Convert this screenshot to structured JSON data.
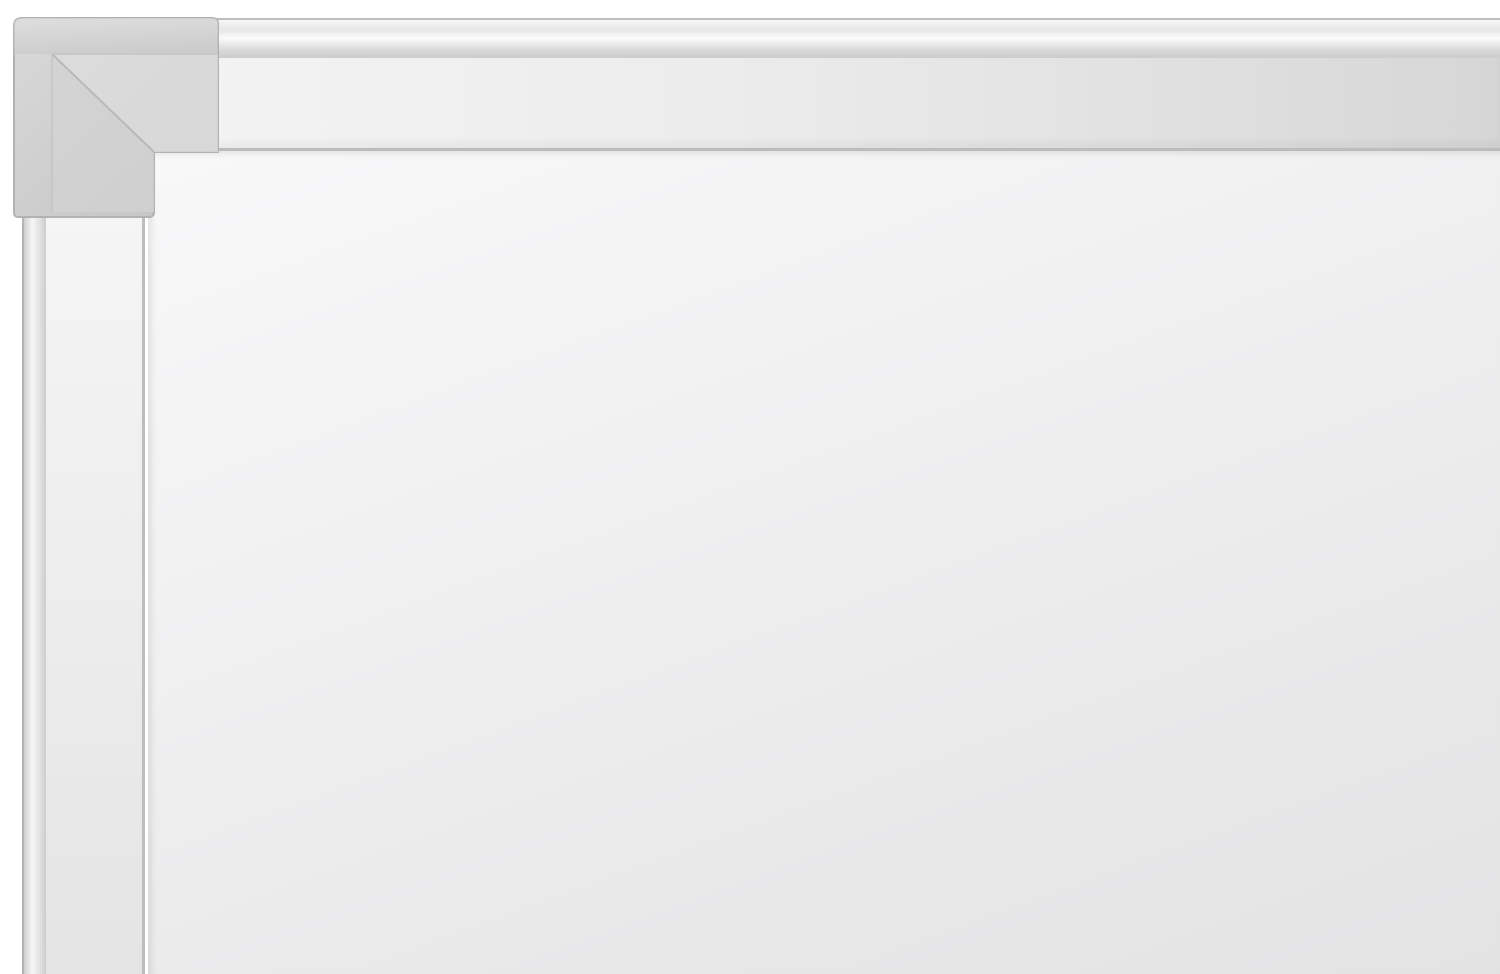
{
  "scene": {
    "subject": "",
    "colors": {
      "frame": "#e6e6e6",
      "corner_cap": "#c9c9c9",
      "surface": "#f1f1f2"
    },
    "icons": [
      "corner-cap-icon"
    ]
  }
}
